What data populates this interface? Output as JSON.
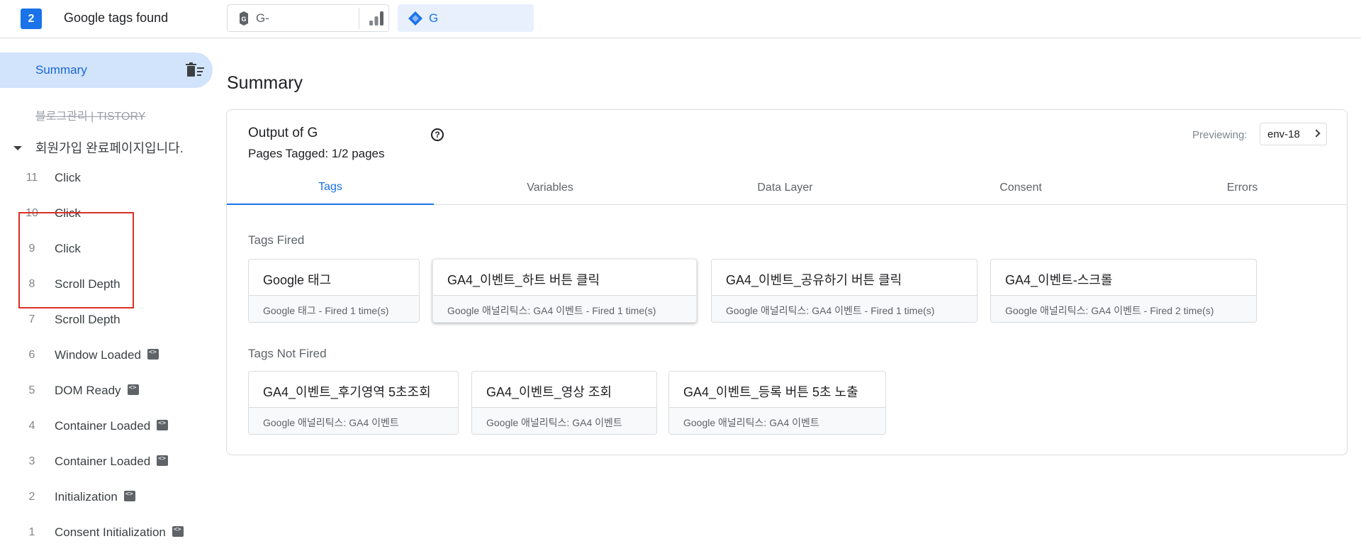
{
  "topbar": {
    "tag_count": "2",
    "found_label": "Google tags found",
    "chips": [
      {
        "label": "G-",
        "icon": "google-tag-icon"
      },
      {
        "label": "G",
        "icon": "gtm-icon"
      }
    ]
  },
  "sidebar": {
    "summary_label": "Summary",
    "blog_label": "블로그관리 | TISTORY",
    "page_label": "회원가입 완료페이지입니다.",
    "events": [
      {
        "num": "11",
        "name": "Click",
        "code": false
      },
      {
        "num": "10",
        "name": "Click",
        "code": false
      },
      {
        "num": "9",
        "name": "Click",
        "code": false
      },
      {
        "num": "8",
        "name": "Scroll Depth",
        "code": false
      },
      {
        "num": "7",
        "name": "Scroll Depth",
        "code": false
      },
      {
        "num": "6",
        "name": "Window Loaded",
        "code": true
      },
      {
        "num": "5",
        "name": "DOM Ready",
        "code": true
      },
      {
        "num": "4",
        "name": "Container Loaded",
        "code": true
      },
      {
        "num": "3",
        "name": "Container Loaded",
        "code": true
      },
      {
        "num": "2",
        "name": "Initialization",
        "code": true
      },
      {
        "num": "1",
        "name": "Consent Initialization",
        "code": true
      }
    ]
  },
  "main": {
    "title": "Summary",
    "output_title": "Output of G",
    "pages_tagged": "Pages Tagged: 1/2 pages",
    "previewing_label": "Previewing:",
    "env": "env-18",
    "tabs": [
      {
        "label": "Tags",
        "active": true
      },
      {
        "label": "Variables",
        "active": false
      },
      {
        "label": "Data Layer",
        "active": false
      },
      {
        "label": "Consent",
        "active": false
      },
      {
        "label": "Errors",
        "active": false
      }
    ],
    "fired_label": "Tags Fired",
    "fired": [
      {
        "name": "Google 태그",
        "sub": "Google 태그 - Fired 1 time(s)"
      },
      {
        "name": "GA4_이벤트_하트 버튼 클릭",
        "sub": "Google 애널리틱스: GA4 이벤트 - Fired 1 time(s)"
      },
      {
        "name": "GA4_이벤트_공유하기 버튼 클릭",
        "sub": "Google 애널리틱스: GA4 이벤트 - Fired 1 time(s)"
      },
      {
        "name": "GA4_이벤트-스크롤",
        "sub": "Google 애널리틱스: GA4 이벤트 - Fired 2 time(s)"
      }
    ],
    "not_fired_label": "Tags Not Fired",
    "not_fired": [
      {
        "name": "GA4_이벤트_후기영역 5초조회",
        "sub": "Google 애널리틱스: GA4 이벤트"
      },
      {
        "name": "GA4_이벤트_영상 조회",
        "sub": "Google 애널리틱스: GA4 이벤트"
      },
      {
        "name": "GA4_이벤트_등록 버튼 5초 노출",
        "sub": "Google 애널리틱스: GA4 이벤트"
      }
    ]
  },
  "colors": {
    "accent": "#1a73e8",
    "highlight": "#d93025",
    "selected_bg": "#d2e3fc"
  }
}
